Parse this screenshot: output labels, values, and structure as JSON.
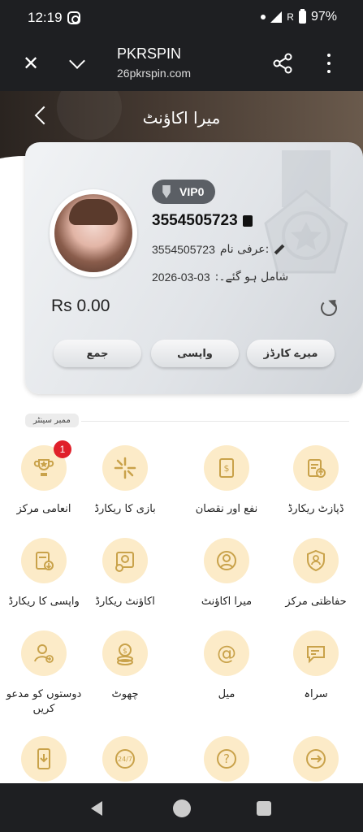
{
  "status_bar": {
    "time": "12:19",
    "battery": "97%",
    "roaming": "R"
  },
  "browser": {
    "title": "PKRSPIN",
    "url": "26pkrspin.com"
  },
  "header": {
    "title": "میرا اکاؤنٹ"
  },
  "account": {
    "vip": "VIP0",
    "user_id": "3554505723",
    "nickname_label": "عرفی نام:",
    "nickname": "3554505723",
    "joined_date": "2026-03-03",
    "joined_label": ":شامل ہو گئے۔",
    "balance": "Rs 0.00",
    "buttons": {
      "deposit": "جمع",
      "withdraw": "واپسی",
      "my_cards": "میرے کارڈز"
    }
  },
  "member_center": {
    "label": "ممبر سینٹر",
    "items": [
      {
        "label": "انعامی مرکز",
        "icon": "trophy-icon",
        "badge": "1"
      },
      {
        "label": "بازی کا ریکارڈ",
        "icon": "spin-icon"
      },
      {
        "label": "نفع اور نقصان",
        "icon": "profit-loss-icon"
      },
      {
        "label": "ڈپازٹ ریکارڈ",
        "icon": "deposit-record-icon"
      },
      {
        "label": "واپسی کا ریکارڈ",
        "icon": "withdraw-record-icon"
      },
      {
        "label": "اکاؤنٹ ریکارڈ",
        "icon": "account-record-icon"
      },
      {
        "label": "میرا اکاؤنٹ",
        "icon": "user-icon"
      },
      {
        "label": "حفاظتی مرکز",
        "icon": "shield-icon"
      },
      {
        "label": "دوستوں کو مدعو کریں",
        "icon": "invite-icon"
      },
      {
        "label": "چھوٹ",
        "icon": "coins-icon"
      },
      {
        "label": "میل",
        "icon": "mail-icon"
      },
      {
        "label": "سراہ",
        "icon": "feedback-icon"
      },
      {
        "label": "",
        "icon": "download-icon"
      },
      {
        "label": "",
        "icon": "support-24-7-icon"
      },
      {
        "label": "",
        "icon": "help-icon"
      },
      {
        "label": "",
        "icon": "logout-icon"
      }
    ]
  },
  "colors": {
    "accent": "#c9a24a",
    "icon_bg": "#fcebc8",
    "badge": "#e0202a"
  }
}
